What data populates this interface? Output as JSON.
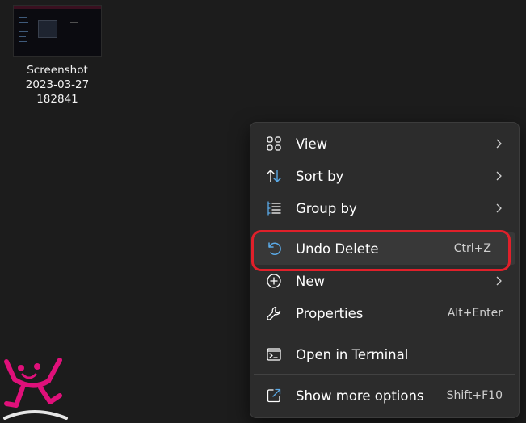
{
  "desktop": {
    "file": {
      "label_line1": "Screenshot",
      "label_line2": "2023-03-27",
      "label_line3": "182841"
    }
  },
  "context_menu": {
    "items": [
      {
        "label": "View",
        "icon": "grid-icon",
        "has_submenu": true
      },
      {
        "label": "Sort by",
        "icon": "sort-icon",
        "has_submenu": true
      },
      {
        "label": "Group by",
        "icon": "group-list-icon",
        "has_submenu": true
      },
      {
        "label": "Undo Delete",
        "icon": "undo-icon",
        "shortcut": "Ctrl+Z",
        "highlighted": true
      },
      {
        "label": "New",
        "icon": "plus-circle-icon",
        "has_submenu": true
      },
      {
        "label": "Properties",
        "icon": "wrench-icon",
        "shortcut": "Alt+Enter"
      },
      {
        "label": "Open in Terminal",
        "icon": "terminal-icon"
      },
      {
        "label": "Show more options",
        "icon": "external-link-icon",
        "shortcut": "Shift+F10"
      }
    ]
  },
  "colors": {
    "background": "#1c1c1c",
    "menu_background": "#2c2c2c",
    "highlight_ring": "#e0202a",
    "accent_icon": "#5aa9e6",
    "logo": "#e0107a"
  }
}
